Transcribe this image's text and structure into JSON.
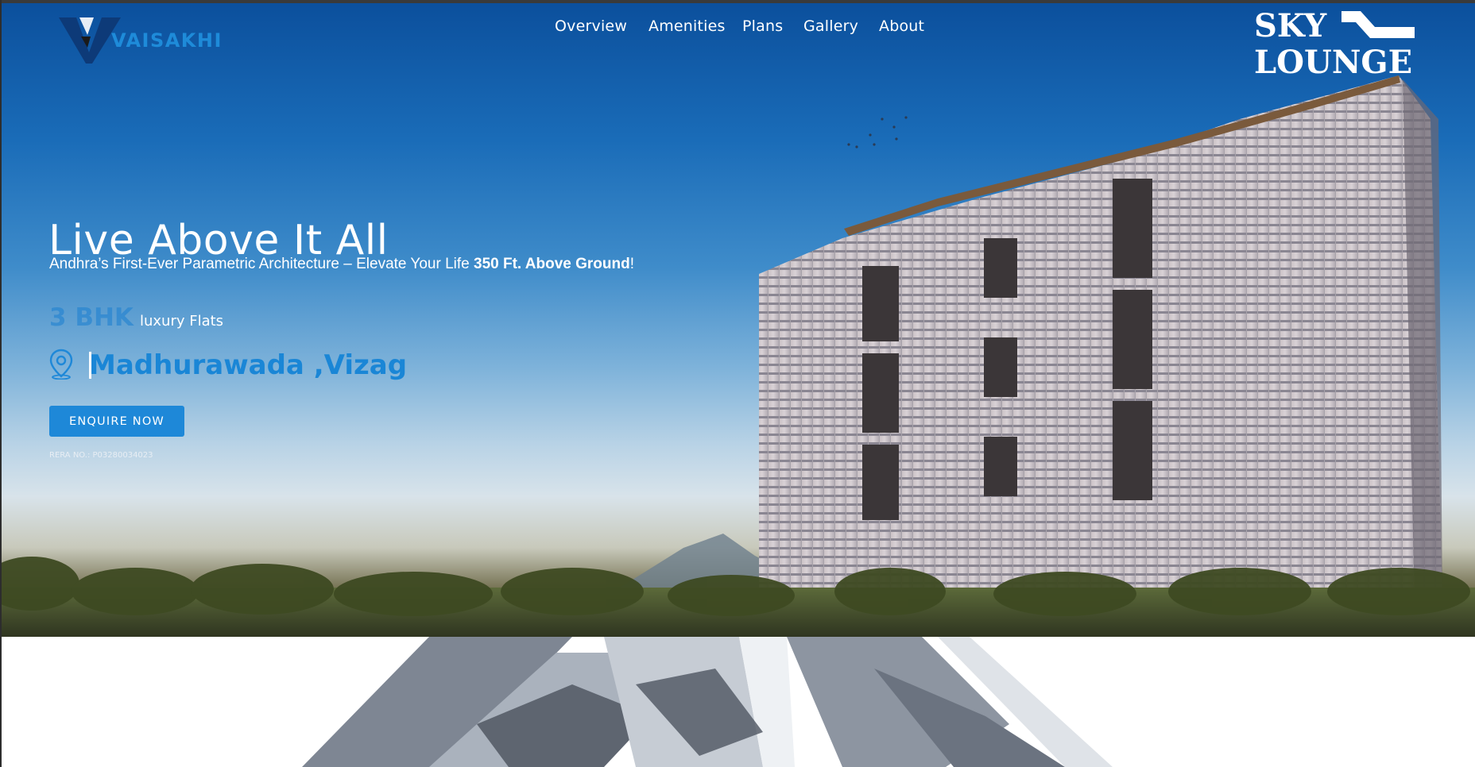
{
  "brand": {
    "logo_text": "VAISAKHI"
  },
  "nav": {
    "items": [
      "Overview",
      "Amenities",
      "Plans",
      "Gallery",
      "About"
    ]
  },
  "project_logo": {
    "line1": "SKY",
    "line2": "LOUNGE"
  },
  "hero": {
    "title": "Live Above It All",
    "subtitle_prefix": "Andhra’s First-Ever Parametric Architecture – Elevate Your Life ",
    "subtitle_bold": "350 Ft. Above Ground",
    "subtitle_suffix": "!",
    "bhk_type": "3 BHK",
    "bhk_desc": "luxury Flats",
    "location": "Madhurawada ,Vizag",
    "cta_label": "ENQUIRE NOW",
    "rera": "RERA NO.: P03280034023"
  },
  "icons": {
    "logo": "vaisakhi-logo-icon",
    "location": "map-pin-icon"
  },
  "colors": {
    "accent": "#1e88d8",
    "sky_top": "#0b4f9c",
    "text_light": "#ffffff"
  }
}
